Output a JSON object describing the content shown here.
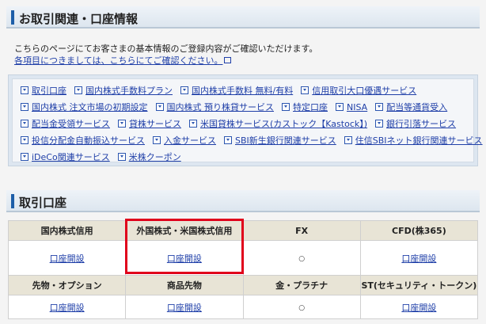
{
  "section1": {
    "title": "お取引関連・口座情報"
  },
  "intro": {
    "line1": "こちらのページにてお客さまの基本情報のご登録内容がご確認いただけます。",
    "line2_link": "各項目につきましては、こちらにてご確認ください。"
  },
  "links": {
    "rows": [
      [
        "取引口座",
        "国内株式手数料プラン",
        "国内株式手数料 無料/有料",
        "信用取引大口優遇サービス"
      ],
      [
        "国内株式 注文市場の初期設定",
        "国内株式 預り株貸サービス",
        "特定口座",
        "NISA",
        "配当等通貨受入"
      ],
      [
        "配当金受領サービス",
        "貸株サービス",
        "米国貸株サービス(カストック【Kastock】)",
        "銀行引落サービス"
      ],
      [
        "投信分配金自動振込サービス",
        "入金サービス",
        "SBI新生銀行関連サービス",
        "住信SBIネット銀行関連サービス"
      ],
      [
        "iDeCo関連サービス",
        "米株クーポン"
      ]
    ],
    "icon": "chevron-down-icon"
  },
  "section2": {
    "title": "取引口座"
  },
  "accounts": {
    "row1_headers": [
      "国内株式信用",
      "外国株式・米国株式信用",
      "FX",
      "CFD(株365)"
    ],
    "row1_values": [
      {
        "type": "link",
        "text": "口座開設"
      },
      {
        "type": "link",
        "text": "口座開設"
      },
      {
        "type": "mark",
        "text": "○"
      },
      {
        "type": "link",
        "text": "口座開設"
      }
    ],
    "row2_headers": [
      "先物・オプション",
      "商品先物",
      "金・プラチナ",
      "ST(セキュリティ・トークン)"
    ],
    "row2_values": [
      {
        "type": "link",
        "text": "口座開設"
      },
      {
        "type": "link",
        "text": "口座開設"
      },
      {
        "type": "mark",
        "text": "○"
      },
      {
        "type": "link",
        "text": "口座開設"
      }
    ],
    "highlight_color": "#e0001b"
  },
  "colors": {
    "link": "#1f3fa8",
    "accent_bar": "#1d5ea8",
    "table_header_bg": "#e8e4d6"
  }
}
